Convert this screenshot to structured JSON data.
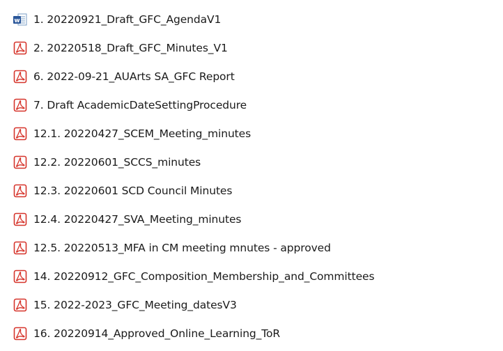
{
  "files": [
    {
      "name": "1. 20220921_Draft_GFC_AgendaV1",
      "icon": "word-doc-icon"
    },
    {
      "name": "2. 20220518_Draft_GFC_Minutes_V1",
      "icon": "pdf-icon"
    },
    {
      "name": "6. 2022-09-21_AUArts SA_GFC Report",
      "icon": "pdf-icon"
    },
    {
      "name": "7. Draft AcademicDateSettingProcedure",
      "icon": "pdf-icon"
    },
    {
      "name": "12.1. 20220427_SCEM_Meeting_minutes",
      "icon": "pdf-icon"
    },
    {
      "name": "12.2. 20220601_SCCS_minutes",
      "icon": "pdf-icon"
    },
    {
      "name": "12.3. 20220601 SCD Council Minutes",
      "icon": "pdf-icon"
    },
    {
      "name": "12.4. 20220427_SVA_Meeting_minutes",
      "icon": "pdf-icon"
    },
    {
      "name": "12.5. 20220513_MFA in CM meeting mnutes - approved",
      "icon": "pdf-icon"
    },
    {
      "name": "14. 20220912_GFC_Composition_Membership_and_Committees",
      "icon": "pdf-icon"
    },
    {
      "name": "15. 2022-2023_GFC_Meeting_datesV3",
      "icon": "pdf-icon"
    },
    {
      "name": "16. 20220914_Approved_Online_Learning_ToR",
      "icon": "pdf-icon"
    }
  ],
  "colors": {
    "pdf_red": "#d6332a",
    "word_blue": "#2b579a"
  }
}
